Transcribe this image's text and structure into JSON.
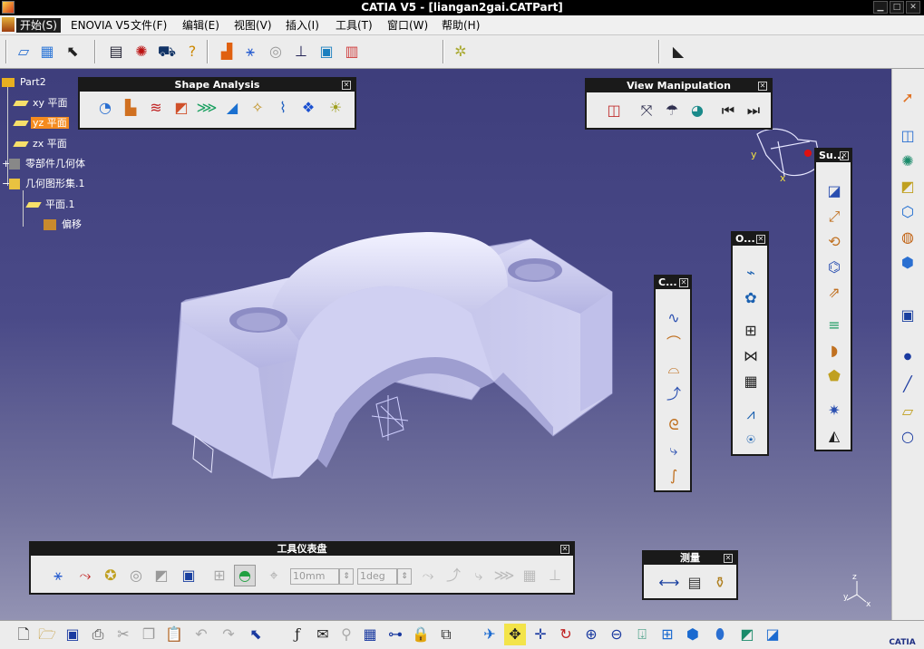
{
  "window": {
    "title": "CATIA V5 - [liangan2gai.CATPart]"
  },
  "menu": {
    "items": [
      "开始(S)",
      "ENOVIA V5",
      "文件(F)",
      "编辑(E)",
      "视图(V)",
      "插入(I)",
      "工具(T)",
      "窗口(W)",
      "帮助(H)"
    ]
  },
  "tree": {
    "root": "Part2",
    "nodes": [
      "xy 平面",
      "yz 平面",
      "zx 平面",
      "零部件几何体",
      "几何图形集.1",
      "平面.1",
      "偏移"
    ],
    "selected": "yz 平面"
  },
  "toolbars": {
    "shape_analysis": {
      "title": "Shape Analysis"
    },
    "view_manipulation": {
      "title": "View Manipulation"
    },
    "dashboard": {
      "title": "工具仪表盘",
      "offset_value": "10mm",
      "angle_value": "1deg"
    },
    "measure": {
      "title": "测量"
    },
    "curves": {
      "title": "C..."
    },
    "operations": {
      "title": "O..."
    },
    "surfaces": {
      "title": "Su..."
    }
  },
  "axis": {
    "y_label": "y",
    "x_label": "x",
    "z_label": "z"
  },
  "branding": {
    "logo_text": "CATIA"
  },
  "colors": {
    "selection": "#f58b1f",
    "toolbar_header": "#1a1a1a",
    "viewport_top": "#3e3e7c",
    "viewport_bottom": "#9393b3",
    "part": "#cacaf0"
  }
}
